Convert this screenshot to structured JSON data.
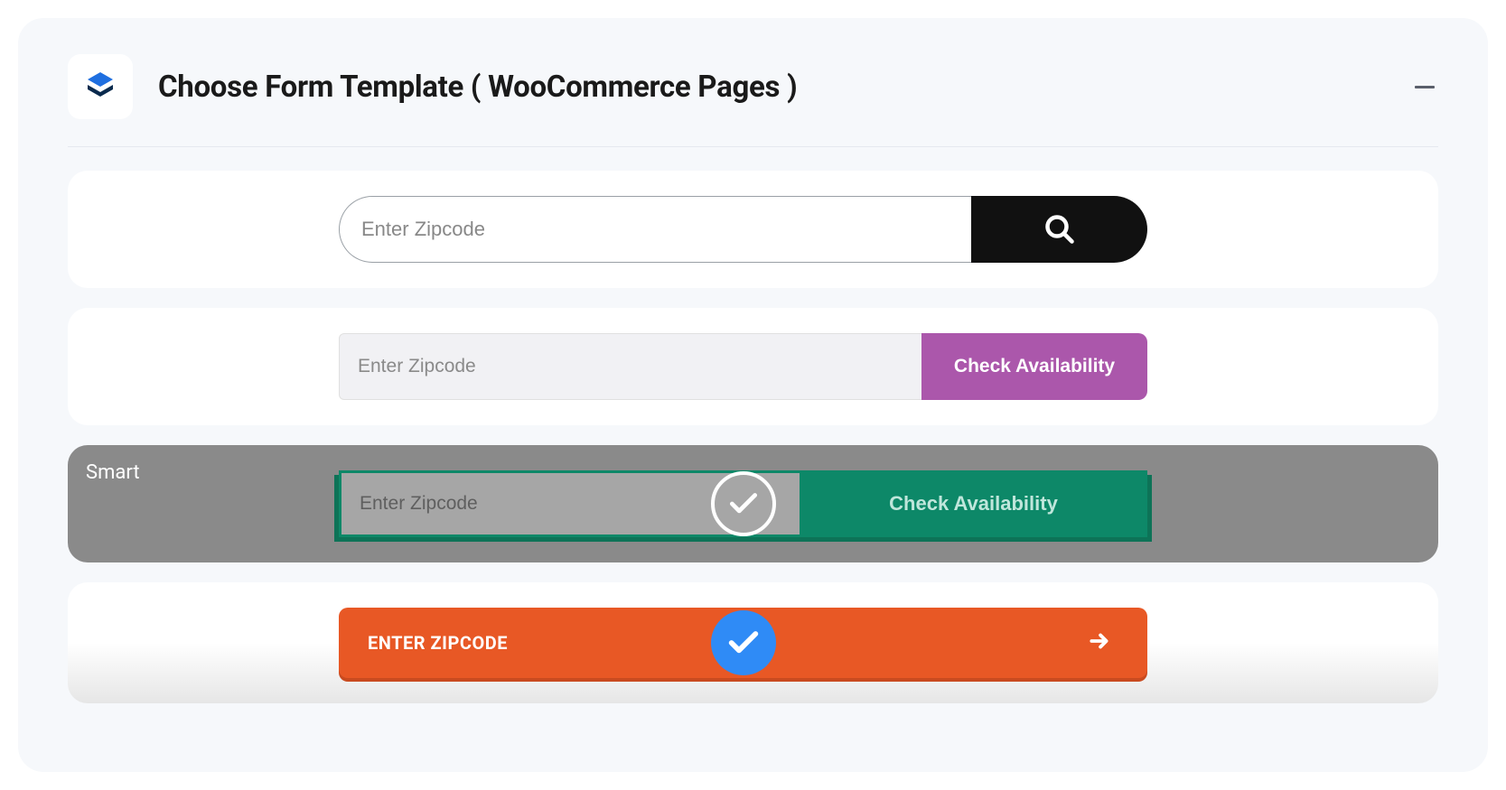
{
  "header": {
    "title": "Choose Form Template ( WooCommerce Pages )"
  },
  "templates": {
    "t1": {
      "placeholder": "Enter Zipcode"
    },
    "t2": {
      "placeholder": "Enter Zipcode",
      "button": "Check Availability"
    },
    "t3": {
      "label": "Smart",
      "placeholder": "Enter Zipcode",
      "button": "Check Availability"
    },
    "t4": {
      "label": "ENTER ZIPCODE"
    }
  }
}
